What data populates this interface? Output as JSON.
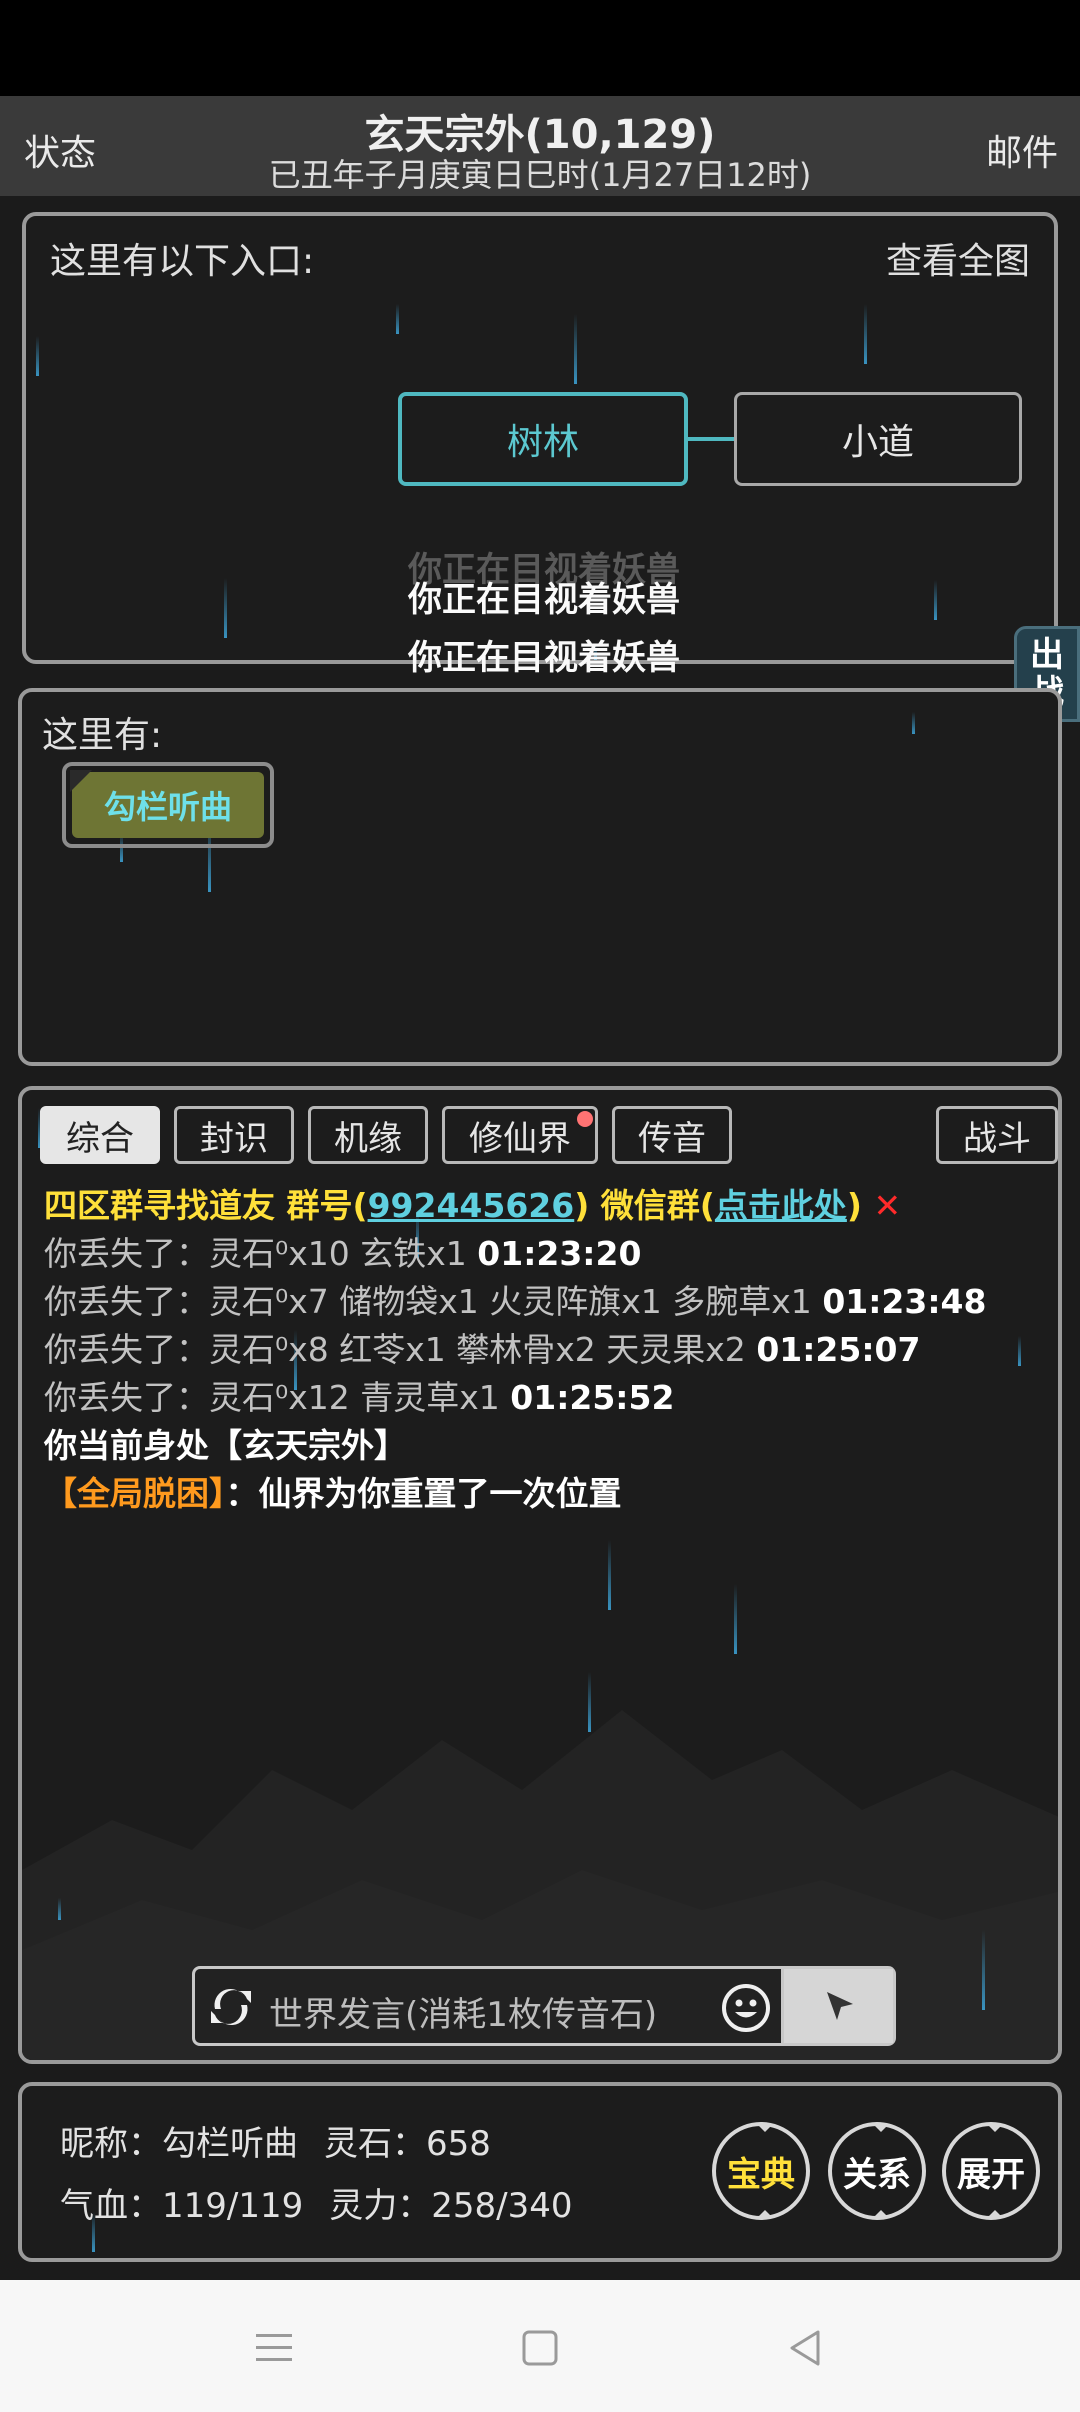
{
  "header": {
    "left_button": "状态",
    "right_button": "邮件",
    "title": "玄天宗外(10,129)",
    "datetime": "已丑年子月庚寅日巳时(1月27日12时)"
  },
  "exits_panel": {
    "label": "这里有以下入口:",
    "map_link": "查看全图",
    "exits": [
      {
        "label": "树林",
        "selected": true
      },
      {
        "label": "小道",
        "selected": false
      }
    ],
    "floating_messages": [
      "你正在目视着妖兽",
      "你正在目视着妖兽",
      "你正在目视着妖兽"
    ]
  },
  "side_tab": {
    "line1": "出",
    "line2": "战"
  },
  "here_panel": {
    "label": "这里有:",
    "npc": "勾栏听曲"
  },
  "chat": {
    "tabs": [
      {
        "label": "综合",
        "active": true
      },
      {
        "label": "封识",
        "active": false
      },
      {
        "label": "机缘",
        "active": false
      },
      {
        "label": "修仙界",
        "active": false,
        "badge": true
      },
      {
        "label": "传音",
        "active": false
      },
      {
        "label": "战斗",
        "active": false
      }
    ],
    "ad": {
      "prefix": "四区群寻找道友 群号(",
      "group_number": "992445626",
      "middle": ") 微信群(",
      "link": "点击此处",
      "suffix": ")",
      "close": "✕"
    },
    "loss_lines": [
      {
        "text": "你丢失了：灵石⁰x10 玄铁x1",
        "time": "01:23:20"
      },
      {
        "text": "你丢失了：灵石⁰x7 储物袋x1 火灵阵旗x1 多腕草x1",
        "time": "01:23:48"
      },
      {
        "text": "你丢失了：灵石⁰x8 红苓x1 攀林骨x2 天灵果x2",
        "time": "01:25:07"
      },
      {
        "text": "你丢失了：灵石⁰x12 青灵草x1",
        "time": "01:25:52"
      }
    ],
    "location_line": "你当前身处【玄天宗外】",
    "global_tag": "【全局脱困】",
    "global_sep": "：",
    "global_msg": "仙界为你重置了一次位置",
    "input_placeholder": "世界发言(消耗1枚传音石)"
  },
  "status": {
    "nickname_label": "昵称：",
    "nickname": "勾栏听曲",
    "stone_label": "灵石：",
    "stone": "658",
    "hp_label": "气血：",
    "hp": "119/119",
    "mp_label": "灵力：",
    "mp": "258/340",
    "buttons": [
      "宝典",
      "关系",
      "展开"
    ]
  },
  "colors": {
    "accent_teal": "#4fb8c0",
    "ad_yellow": "#ffe03a",
    "global_orange": "#ff9a1e",
    "badge_red": "#ff7373"
  }
}
